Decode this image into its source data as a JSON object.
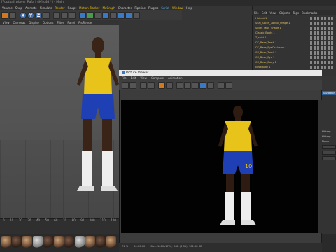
{
  "window": {
    "title": "[Football player Rafa | 4K].c4d *] - Main"
  },
  "menubar": {
    "items": [
      "Volume",
      "Snap",
      "Animate",
      "Simulate",
      "Render",
      "Sculpt",
      "Motion Tracker",
      "MoGraph",
      "Character",
      "Pipeline",
      "Plugins",
      "Script",
      "Window",
      "Help"
    ]
  },
  "viewport": {
    "menu": [
      "View",
      "Cameras",
      "Display",
      "Options",
      "Filter",
      "Panel",
      "ProRender"
    ],
    "ruler": [
      "0",
      "10",
      "20",
      "30",
      "40",
      "50",
      "60",
      "70",
      "80",
      "90",
      "100",
      "110",
      "120"
    ]
  },
  "object_manager": {
    "menu": [
      "File",
      "Edit",
      "View",
      "Objects",
      "Tags",
      "Bookmarks"
    ],
    "rows": [
      "Haircut 1",
      "SSM_Socks_78980_Shape 1",
      "Socks_MNS_Shape 1",
      "Classic_Boots 1",
      "T_shirt 1",
      "CC_Base_Teeth 1",
      "CC_Base_EyeOcclusion 1",
      "CC_Base_Tooth 1",
      "CC_Base_Eye 1",
      "CC_Base_Body 1",
      "NeckBody 1"
    ]
  },
  "picture_viewer": {
    "title": "Picture Viewer",
    "menu": [
      "File",
      "Edit",
      "View",
      "Compare",
      "Animation"
    ],
    "status": [
      "71 %",
      "00:00:00",
      "Size: 1080x1720, RGB (8 Bit), 101.08 KB"
    ]
  },
  "right_panel": {
    "tab": "Navigator",
    "labels": [
      "History",
      "History",
      "Name"
    ]
  },
  "colors": {
    "shirt": "#e8c41a",
    "shorts": "#1f3fb5",
    "accent": "#f0c000",
    "skin": "#3a2418"
  }
}
